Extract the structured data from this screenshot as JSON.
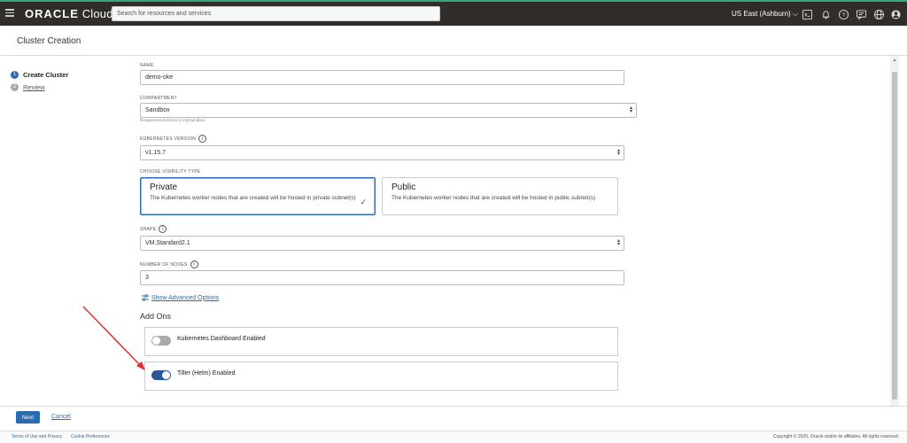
{
  "header": {
    "brand_bold": "ORACLE",
    "brand_light": "Cloud",
    "search_placeholder": "Search for resources and services",
    "region": "US East (Ashburn) ⌵"
  },
  "page": {
    "title": "Cluster Creation"
  },
  "steps": [
    {
      "num": "1",
      "label": "Create Cluster"
    },
    {
      "num": "2",
      "label": "Review"
    }
  ],
  "form": {
    "name": {
      "label": "NAME",
      "value": "demo-oke"
    },
    "compartment": {
      "label": "COMPARTMENT",
      "value": "Sandbox",
      "hint": "flexagonoracledcloud (root)/Sandbox"
    },
    "k8s_version": {
      "label": "KUBERNETES VERSION",
      "value": "v1.15.7"
    },
    "visibility": {
      "label": "CHOOSE VISIBILITY TYPE",
      "private_title": "Private",
      "private_desc": "The Kubernetes worker nodes that are created will be hosted in private subnet(s)",
      "public_title": "Public",
      "public_desc": "The Kubernetes worker nodes that are created will be hosted in public subnet(s)",
      "selected": "Private"
    },
    "shape": {
      "label": "SHAPE",
      "value": "VM.Standard2.1"
    },
    "nodes": {
      "label": "NUMBER OF NODES",
      "value": "3"
    },
    "advanced_link": "Show Advanced Options"
  },
  "addons": {
    "title": "Add Ons",
    "items": [
      {
        "label": "Kubernetes Dashboard Enabled",
        "enabled": false
      },
      {
        "label": "Tiller (Helm) Enabled",
        "enabled": true
      }
    ]
  },
  "actions": {
    "next": "Next",
    "cancel": "Cancel"
  },
  "footer": {
    "terms": "Terms of Use and Privacy",
    "cookies": "Cookie Preferences",
    "copyright": "Copyright © 2020, Oracle and/or its affiliates. All rights reserved."
  },
  "colors": {
    "accent": "#2b6cb0",
    "topbar": "#312d2a",
    "annotation_arrow": "#d9332b"
  }
}
